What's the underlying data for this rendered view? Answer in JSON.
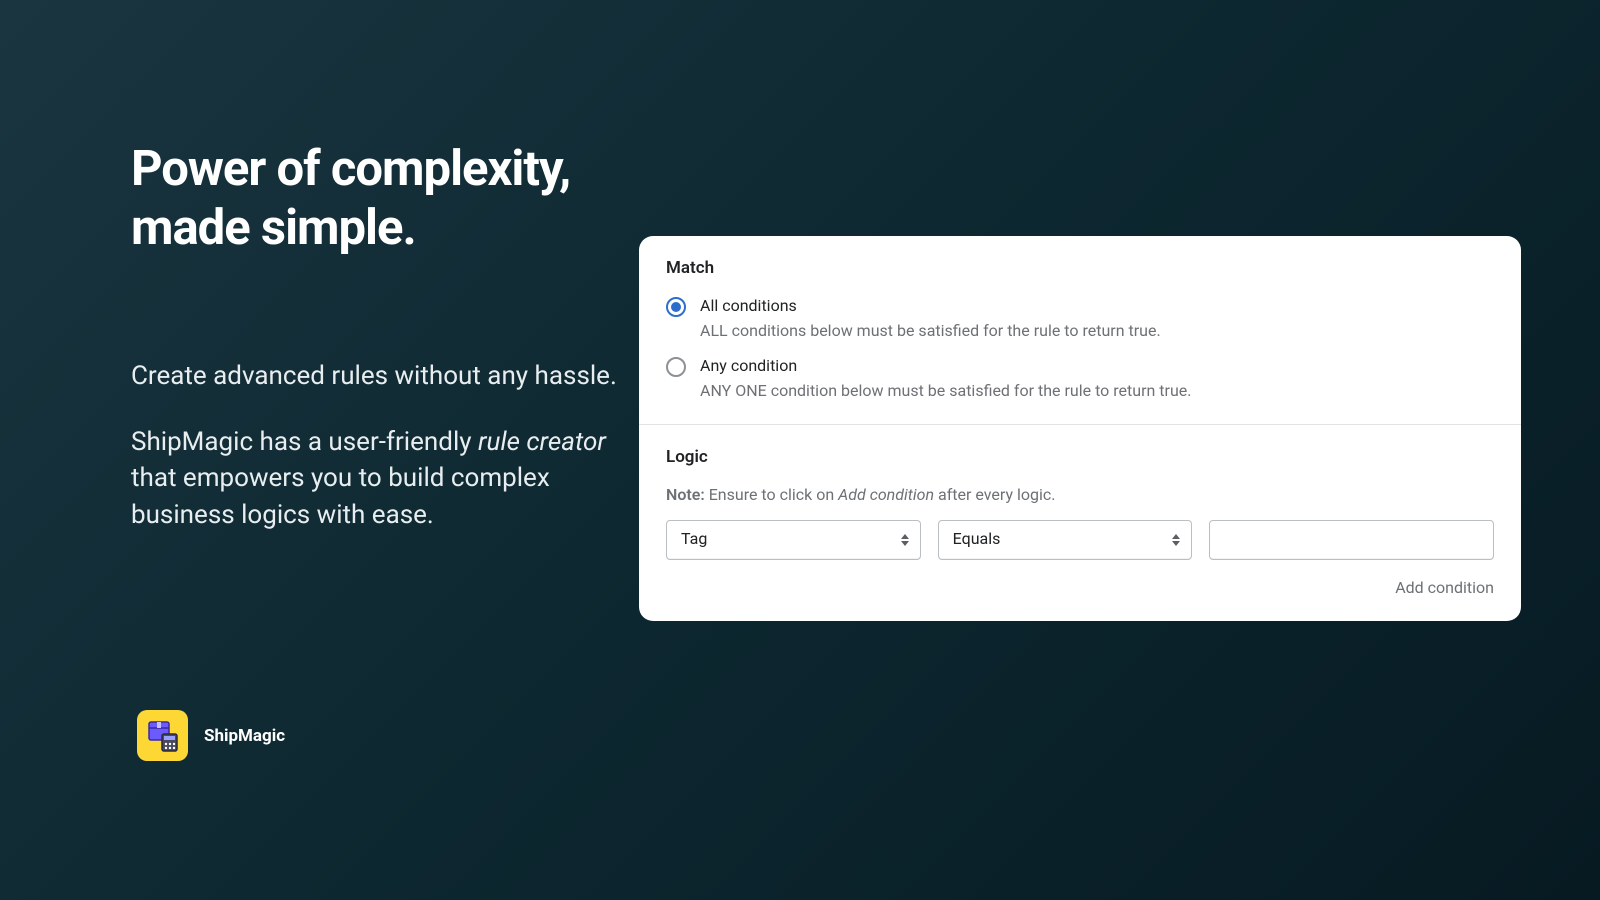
{
  "headline": "Power of complexity, made simple.",
  "body": {
    "p1": "Create advanced rules without any hassle.",
    "p2_pre": "ShipMagic has a user-friendly ",
    "p2_em": "rule creator",
    "p2_post": " that empowers you to build complex business logics with ease."
  },
  "brand": {
    "name": "ShipMagic"
  },
  "card": {
    "match": {
      "title": "Match",
      "options": [
        {
          "label": "All conditions",
          "description": "ALL conditions below must be satisfied for the rule to return true.",
          "selected": true
        },
        {
          "label": "Any condition",
          "description": "ANY ONE condition below must be satisfied for the rule to return true.",
          "selected": false
        }
      ]
    },
    "logic": {
      "title": "Logic",
      "note_label": "Note:",
      "note_pre": " Ensure to click on ",
      "note_em": "Add condition",
      "note_post": " after every logic.",
      "condition": {
        "field": "Tag",
        "operator": "Equals",
        "value": ""
      },
      "add_condition_label": "Add condition"
    }
  }
}
